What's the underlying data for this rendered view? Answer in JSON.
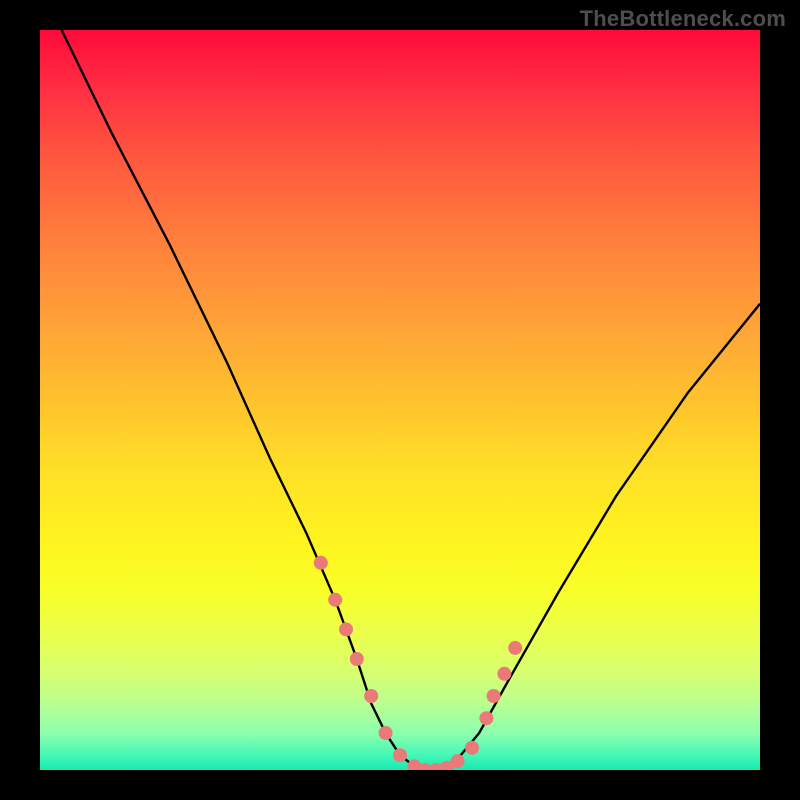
{
  "watermark": "TheBottleneck.com",
  "colors": {
    "dot_fill": "#e97a78",
    "curve_stroke": "#000000"
  },
  "chart_data": {
    "type": "line",
    "title": "",
    "xlabel": "",
    "ylabel": "",
    "xlim": [
      0,
      100
    ],
    "ylim": [
      0,
      100
    ],
    "grid": false,
    "legend": false,
    "series": [
      {
        "name": "left_branch",
        "x": [
          3,
          10,
          18,
          26,
          32,
          37,
          41,
          44,
          46,
          48,
          50,
          52,
          54
        ],
        "y": [
          100,
          86,
          71,
          55,
          42,
          32,
          23,
          15,
          9,
          5,
          2,
          0.5,
          0
        ]
      },
      {
        "name": "right_branch",
        "x": [
          54,
          56,
          58,
          61,
          65,
          72,
          80,
          90,
          100
        ],
        "y": [
          0,
          0.3,
          1.5,
          5,
          12,
          24,
          37,
          51,
          63
        ]
      }
    ],
    "scatter": {
      "name": "dots",
      "x": [
        39,
        41,
        42.5,
        44,
        46,
        48,
        50,
        52,
        53.5,
        55,
        56.5,
        58,
        60,
        62,
        63,
        64.5,
        66
      ],
      "y": [
        28,
        23,
        19,
        15,
        10,
        5,
        2,
        0.5,
        0,
        0,
        0.3,
        1.2,
        3,
        7,
        10,
        13,
        16.5
      ],
      "r": 7
    }
  }
}
